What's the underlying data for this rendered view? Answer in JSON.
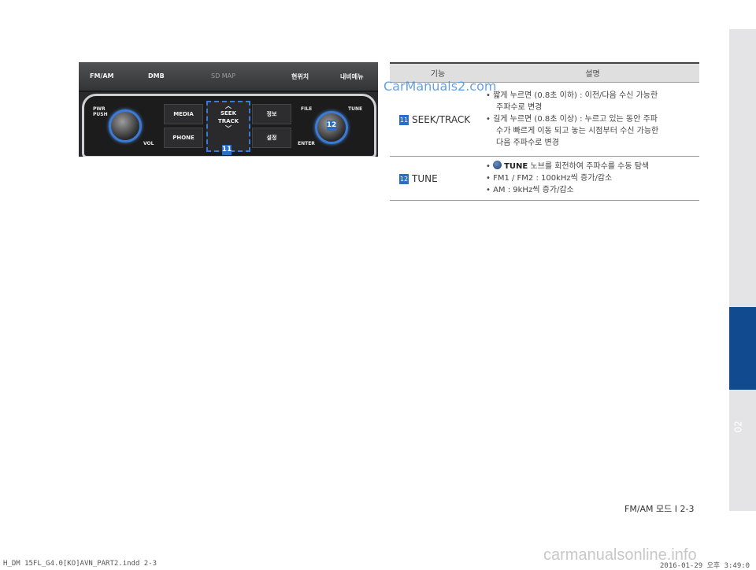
{
  "side_tab": {
    "chapter": "02"
  },
  "panel": {
    "top_buttons": [
      "FM/AM",
      "DMB",
      "SD MAP",
      "현위치",
      "내비메뉴"
    ],
    "pwr_label": "PWR\nPUSH",
    "vol_label": "VOL",
    "media_label": "MEDIA",
    "phone_label": "PHONE",
    "seek_label_1": "SEEK",
    "seek_label_2": "TRACK",
    "info_label": "정보",
    "setup_label": "설정",
    "file_label": "FILE",
    "tune_label": "TUNE",
    "enter_label": "ENTER",
    "badge_11": "11",
    "badge_12": "12"
  },
  "table": {
    "headers": [
      "기능",
      "설명"
    ],
    "rows": [
      {
        "num": "11",
        "function": "SEEK/TRACK",
        "lines": [
          "• 짧게 누르면 (0.8초 이하) : 이전/다음 수신 가능한",
          "주파수로 변경",
          "• 길게 누르면 (0.8초 이상) : 누르고 있는 동안 주파",
          "수가 빠르게 이동 되고 놓는 시점부터 수신 가능한",
          "다음 주파수로 변경"
        ]
      },
      {
        "num": "12",
        "function": "TUNE",
        "line1_prefix": "• ",
        "line1_bold": "TUNE",
        "line1_rest": " 노브를 회전하여 주파수를 수동 탐색",
        "line2": "• FM1 / FM2 : 100kHz씩 증가/감소",
        "line3": "• AM : 9kHz씩 증가/감소"
      }
    ]
  },
  "watermark": "CarManuals2.com",
  "watermark_bottom": "carmanualsonline.info",
  "page_number": "FM/AM 모드 I 2-3",
  "footer_left": "H_DM 15FL_G4.0[KO]AVN_PART2.indd   2-3",
  "footer_right": "2016-01-29   오후 3:49:0"
}
